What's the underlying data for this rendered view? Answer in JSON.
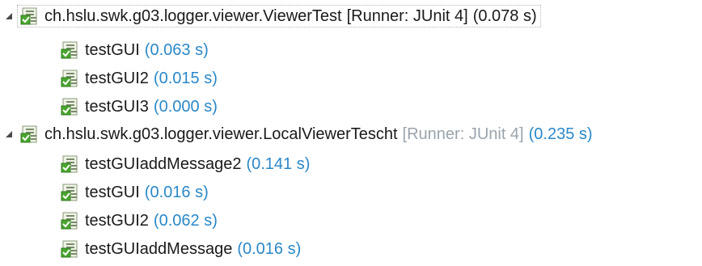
{
  "tree": {
    "suites": [
      {
        "name": "ch.hslu.swk.g03.logger.viewer.ViewerTest",
        "runner": "[Runner: JUnit 4]",
        "time": "(0.078 s)",
        "selected": true,
        "tests": [
          {
            "name": "testGUI",
            "time": "(0.063 s)"
          },
          {
            "name": "testGUI2",
            "time": "(0.015 s)"
          },
          {
            "name": "testGUI3",
            "time": "(0.000 s)"
          }
        ]
      },
      {
        "name": "ch.hslu.swk.g03.logger.viewer.LocalViewerTescht",
        "runner": "[Runner: JUnit 4]",
        "time": "(0.235 s)",
        "selected": false,
        "tests": [
          {
            "name": "testGUIaddMessage2",
            "time": "(0.141 s)"
          },
          {
            "name": "testGUI",
            "time": "(0.016 s)"
          },
          {
            "name": "testGUI2",
            "time": "(0.062 s)"
          },
          {
            "name": "testGUIaddMessage",
            "time": "(0.016 s)"
          }
        ]
      }
    ]
  },
  "colors": {
    "time_text": "#2a88c9",
    "runner_text": "#9aa4ad",
    "pass_icon": "#3f9a2a"
  },
  "icons": {
    "expand": "expanded-triangle-icon",
    "suite": "test-suite-passed-icon",
    "test": "test-passed-icon"
  }
}
